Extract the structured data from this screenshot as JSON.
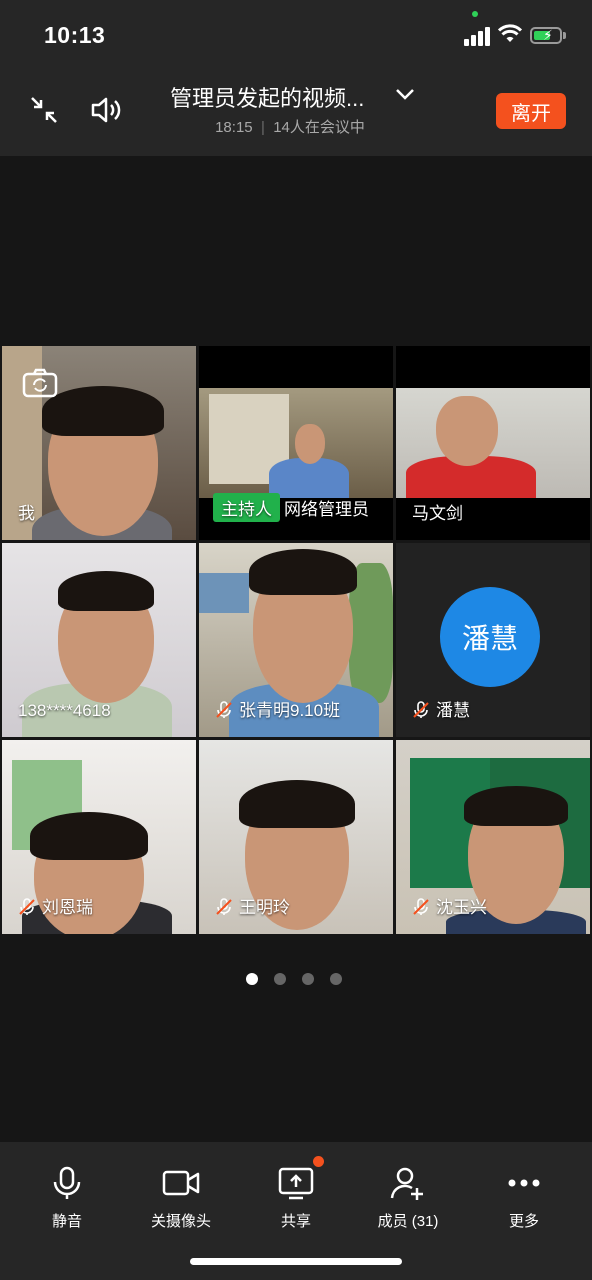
{
  "status_bar": {
    "time": "10:13"
  },
  "header": {
    "title": "管理员发起的视频...",
    "meeting_time": "18:15",
    "participants_in_meeting": "14人在会议中",
    "leave_label": "离开"
  },
  "tiles": [
    {
      "name": "我"
    },
    {
      "host_badge": "主持人",
      "name": "网络管理员"
    },
    {
      "name": "马文剑"
    },
    {
      "name": "138****4618"
    },
    {
      "name": "张青明9.10班",
      "muted": true
    },
    {
      "name": "潘慧",
      "avatar_text": "潘慧",
      "muted": true,
      "avatar_color": "#1e88e5"
    },
    {
      "name": "刘恩瑞",
      "muted": true
    },
    {
      "name": "王明玲",
      "muted": true
    },
    {
      "name": "沈玉兴",
      "muted": true
    }
  ],
  "pager": {
    "pages": 4,
    "current": 1
  },
  "toolbar": {
    "mute_label": "静音",
    "camera_label": "关摄像头",
    "share_label": "共享",
    "members_label": "成员 (31)",
    "more_label": "更多"
  },
  "colors": {
    "accent": "#f4511e",
    "host": "#21b14b",
    "avatar": "#1e88e5"
  }
}
